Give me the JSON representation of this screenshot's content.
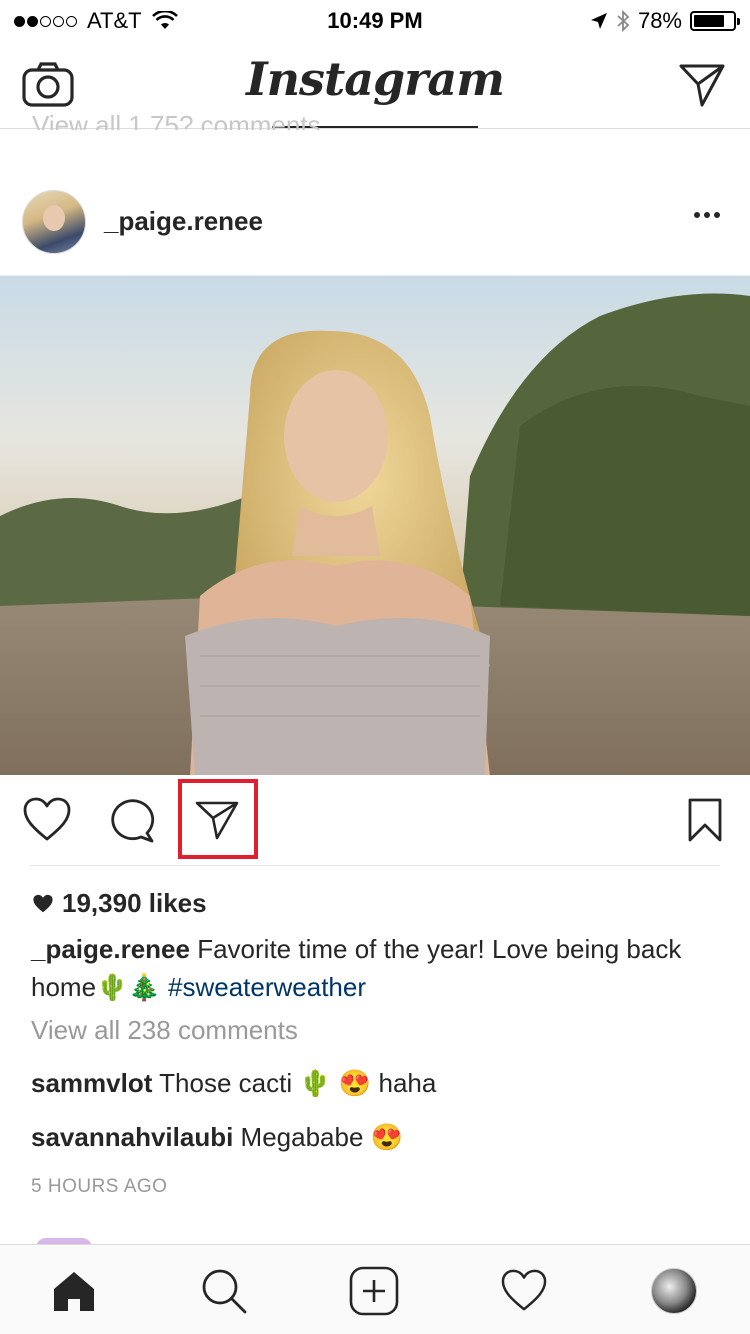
{
  "status_bar": {
    "carrier": "AT&T",
    "time": "10:49 PM",
    "battery_percent_label": "78%",
    "battery_level": 0.78,
    "signal_bars_filled": 2,
    "signal_bars_total": 5
  },
  "header": {
    "logo_text": "Instagram",
    "ghost_text": "View all 1,75? comments"
  },
  "post": {
    "username": "_paige.renee",
    "likes_text": "19,390 likes",
    "caption": {
      "user": "_paige.renee",
      "text": " Favorite time of the year! Love being back home🌵🎄 ",
      "hashtag": "#sweaterweather"
    },
    "view_all_comments": "View all 238 comments",
    "comments": [
      {
        "user": "sammvlot",
        "text": " Those cacti 🌵 😍 haha"
      },
      {
        "user": "savannahvilaubi",
        "text": " Megababe 😍"
      }
    ],
    "timestamp": "5 HOURS AGO"
  },
  "colors": {
    "hashtag": "#003569",
    "highlight": "#e0202e",
    "muted": "#999999"
  },
  "icons": {
    "top_left": "camera-icon",
    "top_right": "direct-message-icon",
    "actions": [
      "heart-icon",
      "comment-icon",
      "send-icon",
      "bookmark-icon"
    ],
    "tabs": [
      "home-icon",
      "search-icon",
      "add-icon",
      "activity-heart-icon",
      "profile-avatar"
    ]
  }
}
